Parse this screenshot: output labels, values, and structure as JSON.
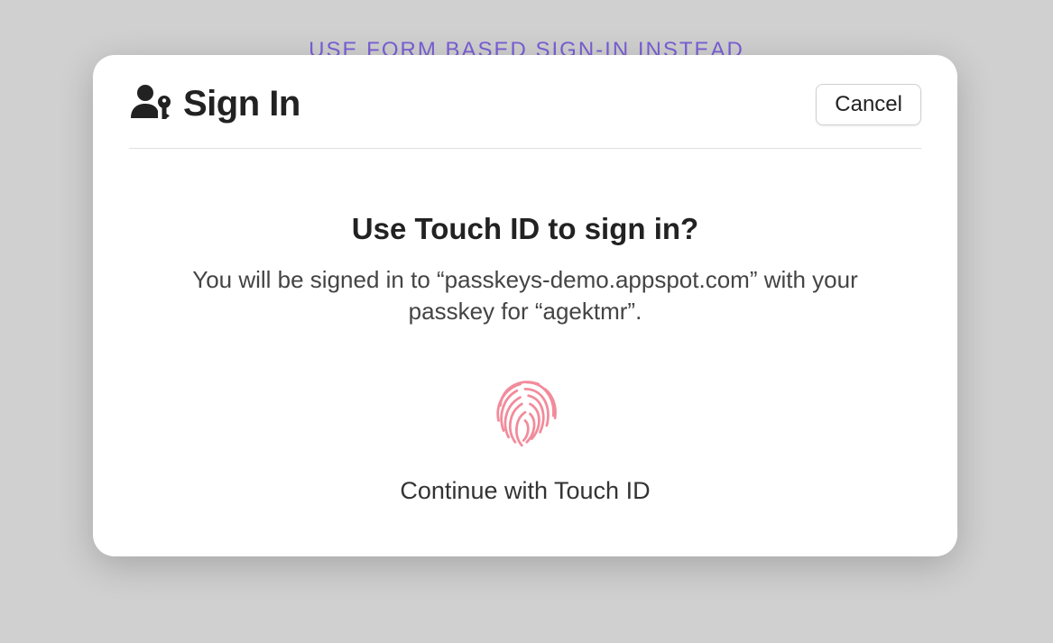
{
  "background": {
    "link_text": "USE FORM BASED SIGN-IN INSTEAD"
  },
  "dialog": {
    "title": "Sign In",
    "cancel_label": "Cancel",
    "prompt_heading": "Use Touch ID to sign in?",
    "prompt_description": "You will be signed in to “passkeys-demo.appspot.com” with your passkey for “agektmr”.",
    "continue_label": "Continue with Touch ID"
  },
  "colors": {
    "link": "#7a5fd6",
    "fingerprint": "#f28b9b"
  }
}
